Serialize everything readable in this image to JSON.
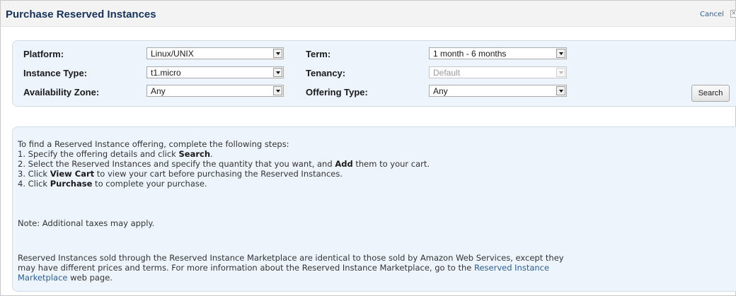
{
  "dialog": {
    "title": "Purchase Reserved Instances",
    "cancel_label": "Cancel"
  },
  "filters": {
    "platform": {
      "label": "Platform:",
      "value": "Linux/UNIX"
    },
    "instance_type": {
      "label": "Instance Type:",
      "value": "t1.micro"
    },
    "availability_zone": {
      "label": "Availability Zone:",
      "value": "Any"
    },
    "term": {
      "label": "Term:",
      "value": "1 month - 6 months"
    },
    "tenancy": {
      "label": "Tenancy:",
      "value": "Default",
      "disabled": true
    },
    "offering_type": {
      "label": "Offering Type:",
      "value": "Any"
    },
    "search_label": "Search"
  },
  "instructions": {
    "intro": "To find a Reserved Instance offering, complete the following steps:",
    "steps": [
      {
        "num": "1.",
        "pre": "Specify the offering details and click ",
        "bold": "Search",
        "post": "."
      },
      {
        "num": "2.",
        "pre": "Select the Reserved Instances and specify the quantity that you want, and ",
        "bold": "Add",
        "post": " them to your cart."
      },
      {
        "num": "3.",
        "pre": "Click ",
        "bold": "View Cart",
        "post": " to view your cart before purchasing the Reserved Instances."
      },
      {
        "num": "4.",
        "pre": "Click ",
        "bold": "Purchase",
        "post": " to complete your purchase."
      }
    ],
    "note": "Note: Additional taxes may apply.",
    "marketplace_line1": "Reserved Instances sold through the Reserved Instance Marketplace are identical to those sold by Amazon Web Services, except they",
    "marketplace_line2_pre": "may have different prices and terms. For more information about the Reserved Instance Marketplace, go to the ",
    "marketplace_link_part1": "Reserved Instance",
    "marketplace_link_part2": "Marketplace",
    "marketplace_line3_post": " web page."
  },
  "colors": {
    "title": "#16325c",
    "panel_bg": "#edf4fb",
    "link": "#2a6099"
  }
}
